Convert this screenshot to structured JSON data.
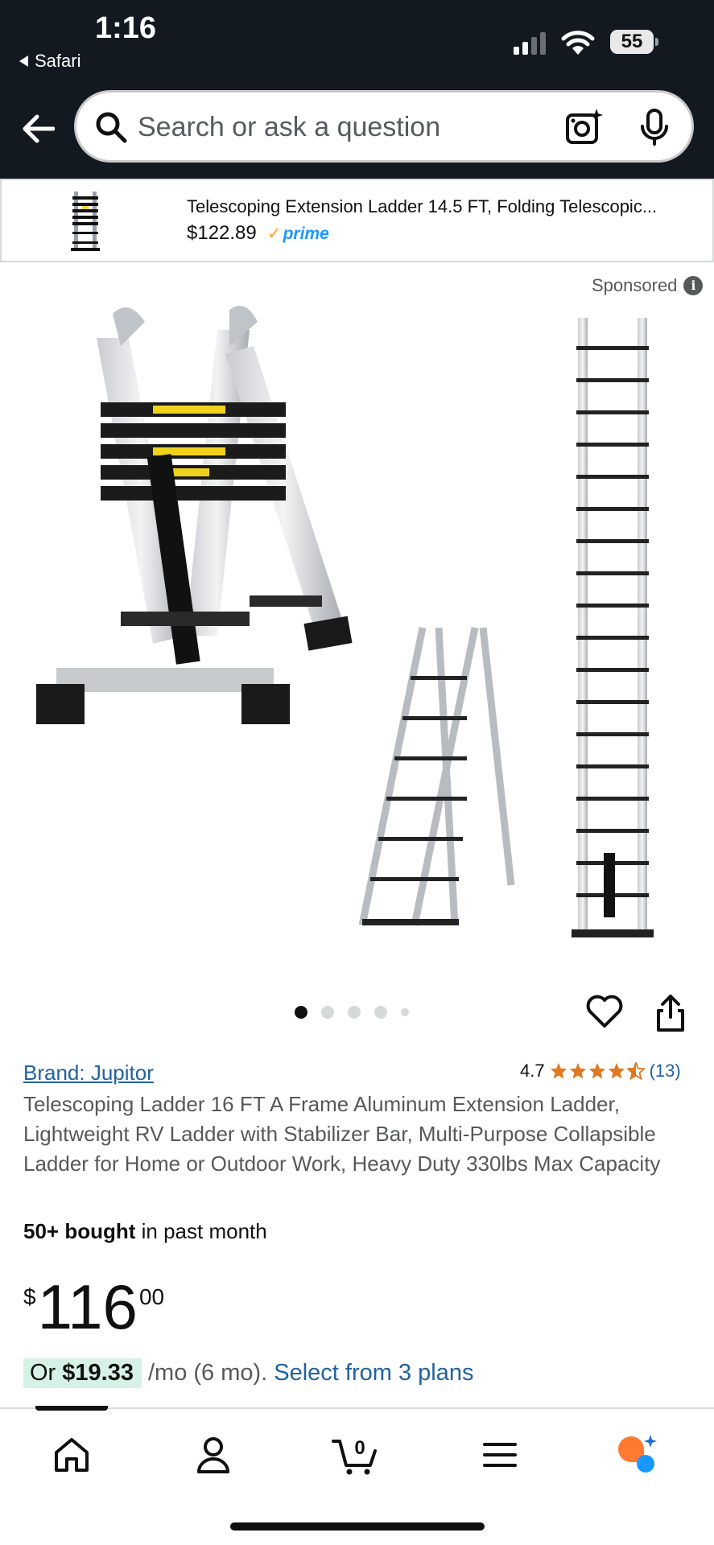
{
  "status_bar": {
    "time": "1:16",
    "back_app": "Safari",
    "battery": "55"
  },
  "search": {
    "placeholder": "Search or ask a question"
  },
  "sticky_bar": {
    "title": "Telescoping Extension Ladder 14.5 FT, Folding Telescopic...",
    "price": "$122.89",
    "prime_label": "prime"
  },
  "sponsored_label": "Sponsored",
  "carousel": {
    "image_count": 5,
    "active_index": 0
  },
  "product": {
    "brand": "Brand: Jupitor",
    "rating": "4.7",
    "rating_stars": 4.7,
    "review_count": "(13)",
    "title": "Telescoping Ladder 16 FT A Frame Aluminum Extension Ladder, Lightweight RV Ladder with Stabilizer Bar, Multi-Purpose Collapsible Ladder for Home or Outdoor Work, Heavy Duty 330lbs Max Capacity",
    "bought_bold": "50+ bought",
    "bought_rest": " in past month",
    "price_symbol": "$",
    "price_whole": "116",
    "price_fraction": "00",
    "installment_prefix": "Or ",
    "installment_amount": "$19.33",
    "installment_term": "/mo (6 mo).",
    "installment_link": "Select from 3 plans"
  },
  "bottom_nav": {
    "items": [
      "home-icon",
      "account-icon",
      "cart-icon",
      "menu-icon",
      "rufus-icon"
    ],
    "cart_count": "0",
    "active": "home-icon"
  },
  "colors": {
    "header_bg": "#131921",
    "link": "#2162a1",
    "star": "#de7921",
    "prime": "#1a98ff",
    "installment_bg": "#d6f1e6",
    "rufus_orange": "#ff7a30",
    "rufus_blue": "#1a98ff"
  }
}
